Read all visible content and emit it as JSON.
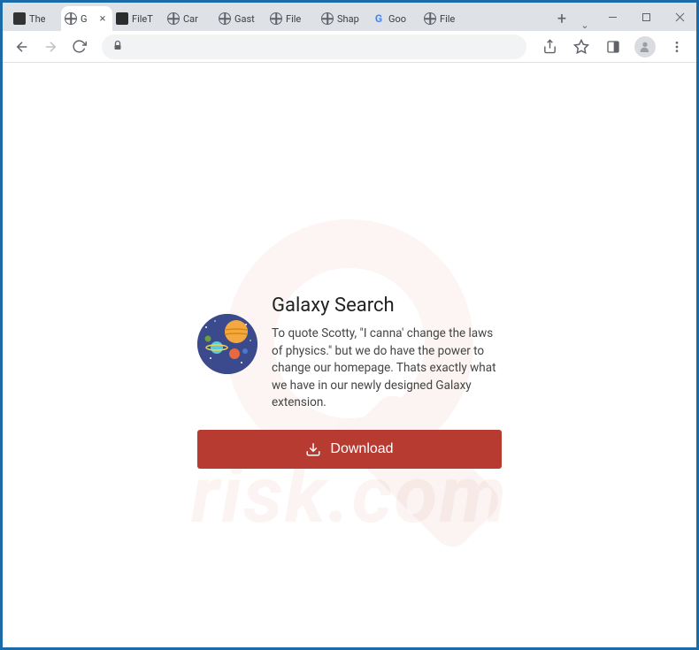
{
  "tabs": [
    {
      "title": "The",
      "favicon": "printer"
    },
    {
      "title": "G",
      "favicon": "globe",
      "active": true
    },
    {
      "title": "FileT",
      "favicon": "folder"
    },
    {
      "title": "Car",
      "favicon": "globe"
    },
    {
      "title": "Gast",
      "favicon": "globe"
    },
    {
      "title": "File",
      "favicon": "globe"
    },
    {
      "title": "Shap",
      "favicon": "globe"
    },
    {
      "title": "Goo",
      "favicon": "google"
    },
    {
      "title": "File",
      "favicon": "globe"
    }
  ],
  "page": {
    "title": "Galaxy Search",
    "description": "To quote Scotty, \"I canna' change the laws of physics.\" but we do have the power to change our homepage. Thats exactly what we have in our newly designed Galaxy extension.",
    "download_label": "Download"
  },
  "watermark": "risk.com"
}
